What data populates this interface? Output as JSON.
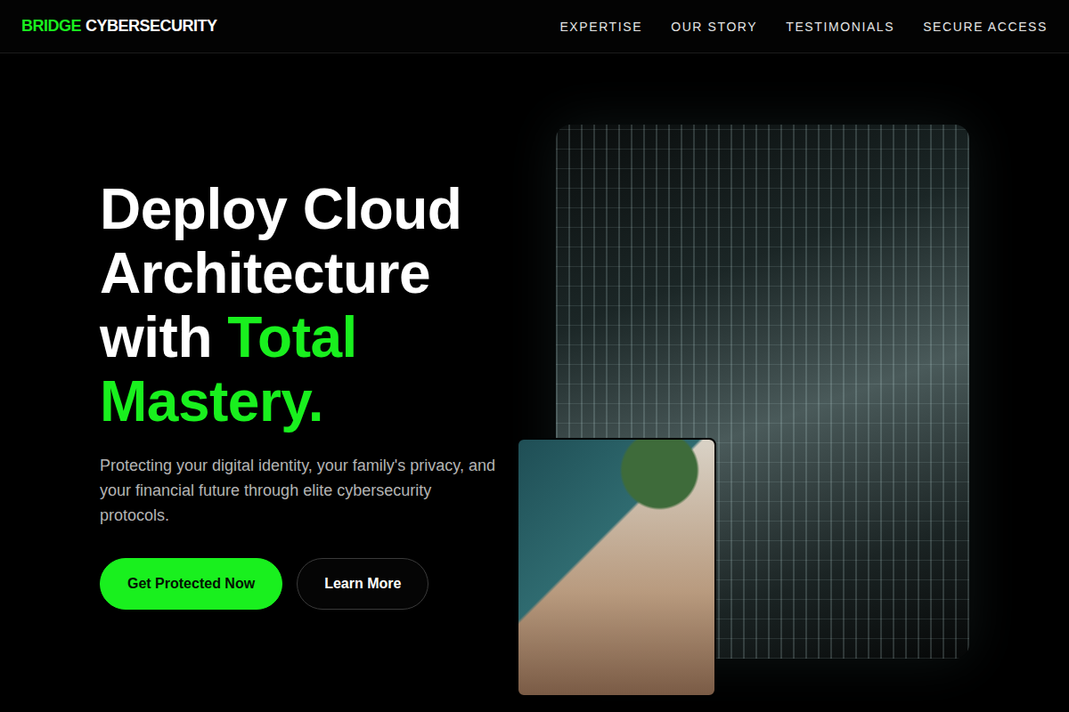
{
  "brand": {
    "accent": "BRIDGE",
    "name": "CYBERSECURITY"
  },
  "nav": [
    "EXPERTISE",
    "OUR STORY",
    "TESTIMONIALS",
    "SECURE ACCESS"
  ],
  "hero": {
    "heading": "Deploy Cloud Architecture with",
    "highlight": "Total Mastery.",
    "description": "Protecting your digital identity, your family's privacy, and your financial future through elite cybersecurity protocols."
  },
  "buttons": [
    {
      "label": "Get Protected Now",
      "kind": "primary"
    },
    {
      "label": "Learn More",
      "kind": "secondary"
    }
  ]
}
